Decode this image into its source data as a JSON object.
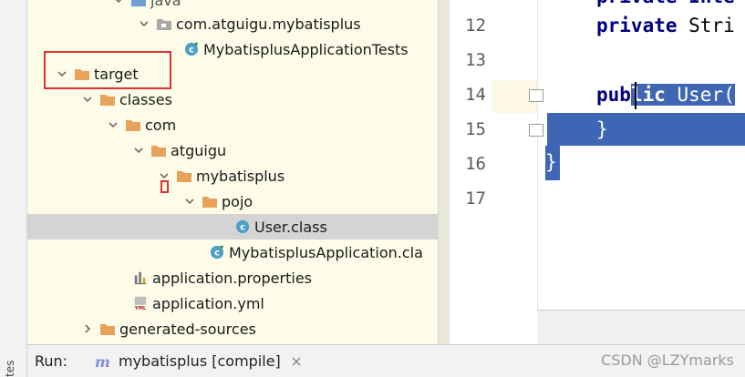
{
  "sidebar": {
    "vertical_label": "tes"
  },
  "tree": {
    "rows": [
      {
        "label": "java",
        "icon": "folder-blue-icon",
        "expanded": true
      },
      {
        "label": "com.atguigu.mybatisplus",
        "icon": "package-icon",
        "expanded": true
      },
      {
        "label": "MybatisplusApplicationTests",
        "icon": "class-icon"
      },
      {
        "label": "target",
        "icon": "folder-orange-icon",
        "expanded": true
      },
      {
        "label": "classes",
        "icon": "folder-orange-icon",
        "expanded": true
      },
      {
        "label": "com",
        "icon": "folder-orange-icon",
        "expanded": true
      },
      {
        "label": "atguigu",
        "icon": "folder-orange-icon",
        "expanded": true
      },
      {
        "label": "mybatisplus",
        "icon": "folder-orange-icon",
        "expanded": true
      },
      {
        "label": "pojo",
        "icon": "folder-orange-icon",
        "expanded": true
      },
      {
        "label": "User.class",
        "icon": "class-icon",
        "selected": true
      },
      {
        "label": "MybatisplusApplication.cla",
        "icon": "class-run-icon"
      },
      {
        "label": "application.properties",
        "icon": "properties-icon"
      },
      {
        "label": "application.yml",
        "icon": "yml-icon"
      },
      {
        "label": "generated-sources",
        "icon": "folder-orange-icon",
        "expanded": false
      }
    ]
  },
  "editor": {
    "line_numbers": [
      "12",
      "13",
      "14",
      "15",
      "16",
      "17"
    ],
    "lines": {
      "l11_fragment": "private Inte",
      "l12_kw": "private",
      "l12_rest": " Stri",
      "l14_kw_a": "pub",
      "l14_kw_b": "lic",
      "l14_rest": " User(",
      "l15": "}",
      "l16": "}"
    }
  },
  "runbar": {
    "label": "Run:",
    "tab_label": "mybatisplus [compile]"
  },
  "watermark": "CSDN @LZYmarks",
  "colors": {
    "tree_bg": "#fcfce8",
    "selection_blue": "#3f66b4",
    "keyword": "#000080",
    "highlight_red": "#e03030",
    "folder_orange": "#e8a25a"
  }
}
